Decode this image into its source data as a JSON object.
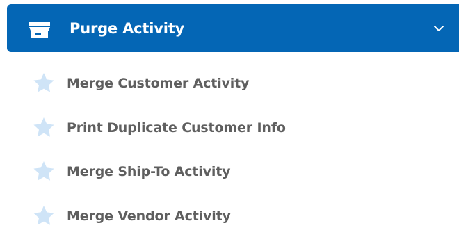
{
  "menu": {
    "title": "Purge Activity",
    "header_icon": "store-icon",
    "toggle_icon": "chevron-down-icon",
    "header_color": "#0466b5",
    "items": [
      {
        "label": "Merge Customer Activity",
        "icon": "star-icon"
      },
      {
        "label": "Print Duplicate Customer Info",
        "icon": "star-icon"
      },
      {
        "label": "Merge Ship-To Activity",
        "icon": "star-icon"
      },
      {
        "label": "Merge Vendor Activity",
        "icon": "star-icon"
      }
    ]
  },
  "colors": {
    "header_background": "#0466b5",
    "header_text": "#ffffff",
    "item_text": "#5f5f5f",
    "star_icon": "#cfe4f7"
  }
}
